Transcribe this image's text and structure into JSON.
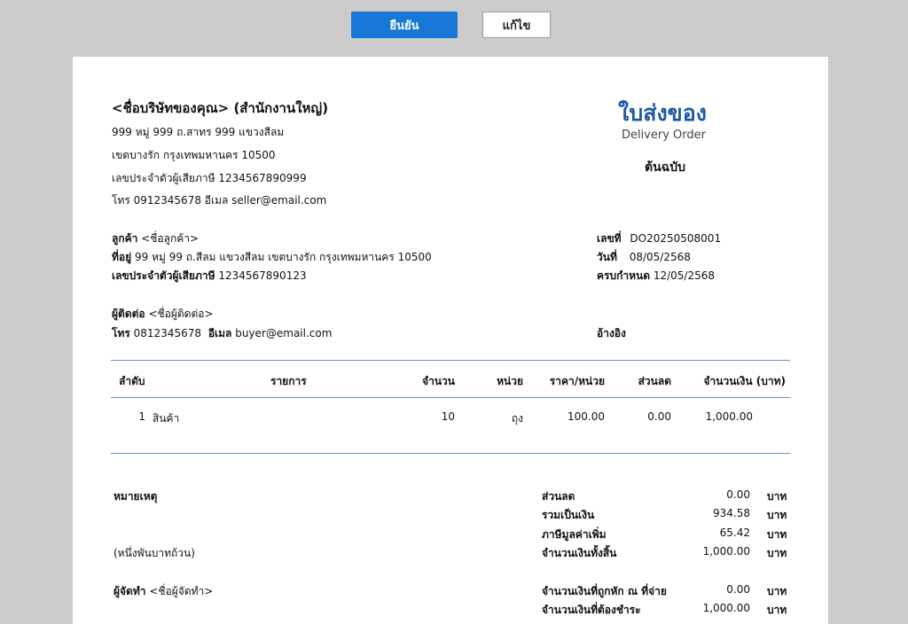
{
  "toolbar": {
    "confirm_label": "ยืนยัน",
    "edit_label": "แก้ไข"
  },
  "seller": {
    "name": "<ชื่อบริษัทของคุณ> (สำนักงานใหญ่)",
    "address1": "999 หมู่ 999 ถ.สาทร 999 แขวงสีลม",
    "address2": "เขตบางรัก  กรุงเทพมหานคร 10500",
    "tax_id_line": "เลขประจำตัวผู้เสียภาษี 1234567890999",
    "contact_line": "โทร 0912345678  อีเมล seller@email.com"
  },
  "document": {
    "title": "ใบส่งของ",
    "subtitle": "Delivery Order",
    "copy_label": "ต้นฉบับ",
    "number_label": "เลขที่",
    "number": "DO20250508001",
    "date_label": "วันที่",
    "date": "08/05/2568",
    "due_label": "ครบกำหนด",
    "due": "12/05/2568",
    "reference_label": "อ้างอิง"
  },
  "customer": {
    "name_label": "ลูกค้า",
    "name": "<ชื่อลูกค้า>",
    "address_label": "ที่อยู่",
    "address": "99 หมู่ 99 ถ.สีลม แขวงสีลม เขตบางรัก กรุงเทพมหานคร 10500",
    "tax_label": "เลขประจำตัวผู้เสียภาษี",
    "tax_id": "1234567890123",
    "contact_label": "ผู้ติดต่อ",
    "contact": "<ชื่อผู้ติดต่อ>",
    "phone_label": "โทร",
    "phone": "0812345678",
    "email_label": "อีเมล",
    "email": "buyer@email.com"
  },
  "table": {
    "headers": [
      "ลำดับ",
      "รายการ",
      "จำนวน",
      "หน่วย",
      "ราคา/หน่วย",
      "ส่วนลด",
      "จำนวนเงิน  (บาท)"
    ],
    "rows": [
      {
        "no": "1",
        "item": "สินค้า",
        "qty": "10",
        "unit": "ถุง",
        "price": "100.00",
        "discount": "0.00",
        "amount": "1,000.00"
      }
    ]
  },
  "notes": {
    "label": "หมายเหตุ",
    "amount_text": "(หนึ่งพันบาทถ้วน)",
    "preparer_label": "ผู้จัดทำ",
    "preparer": "<ชื่อผู้จัดทำ>"
  },
  "summary": {
    "currency": "บาท",
    "lines": [
      {
        "label": "ส่วนลด",
        "value": "0.00"
      },
      {
        "label": "รวมเป็นเงิน",
        "value": "934.58"
      },
      {
        "label": "ภาษีมูลค่าเพิ่ม",
        "value": "65.42"
      },
      {
        "label": "จำนวนเงินทั้งสิ้น",
        "value": "1,000.00"
      },
      {
        "label": "จำนวนเงินที่ถูกหัก ณ ที่จ่าย",
        "value": "0.00"
      },
      {
        "label": "จำนวนเงินที่ต้องชำระ",
        "value": "1,000.00"
      }
    ]
  }
}
